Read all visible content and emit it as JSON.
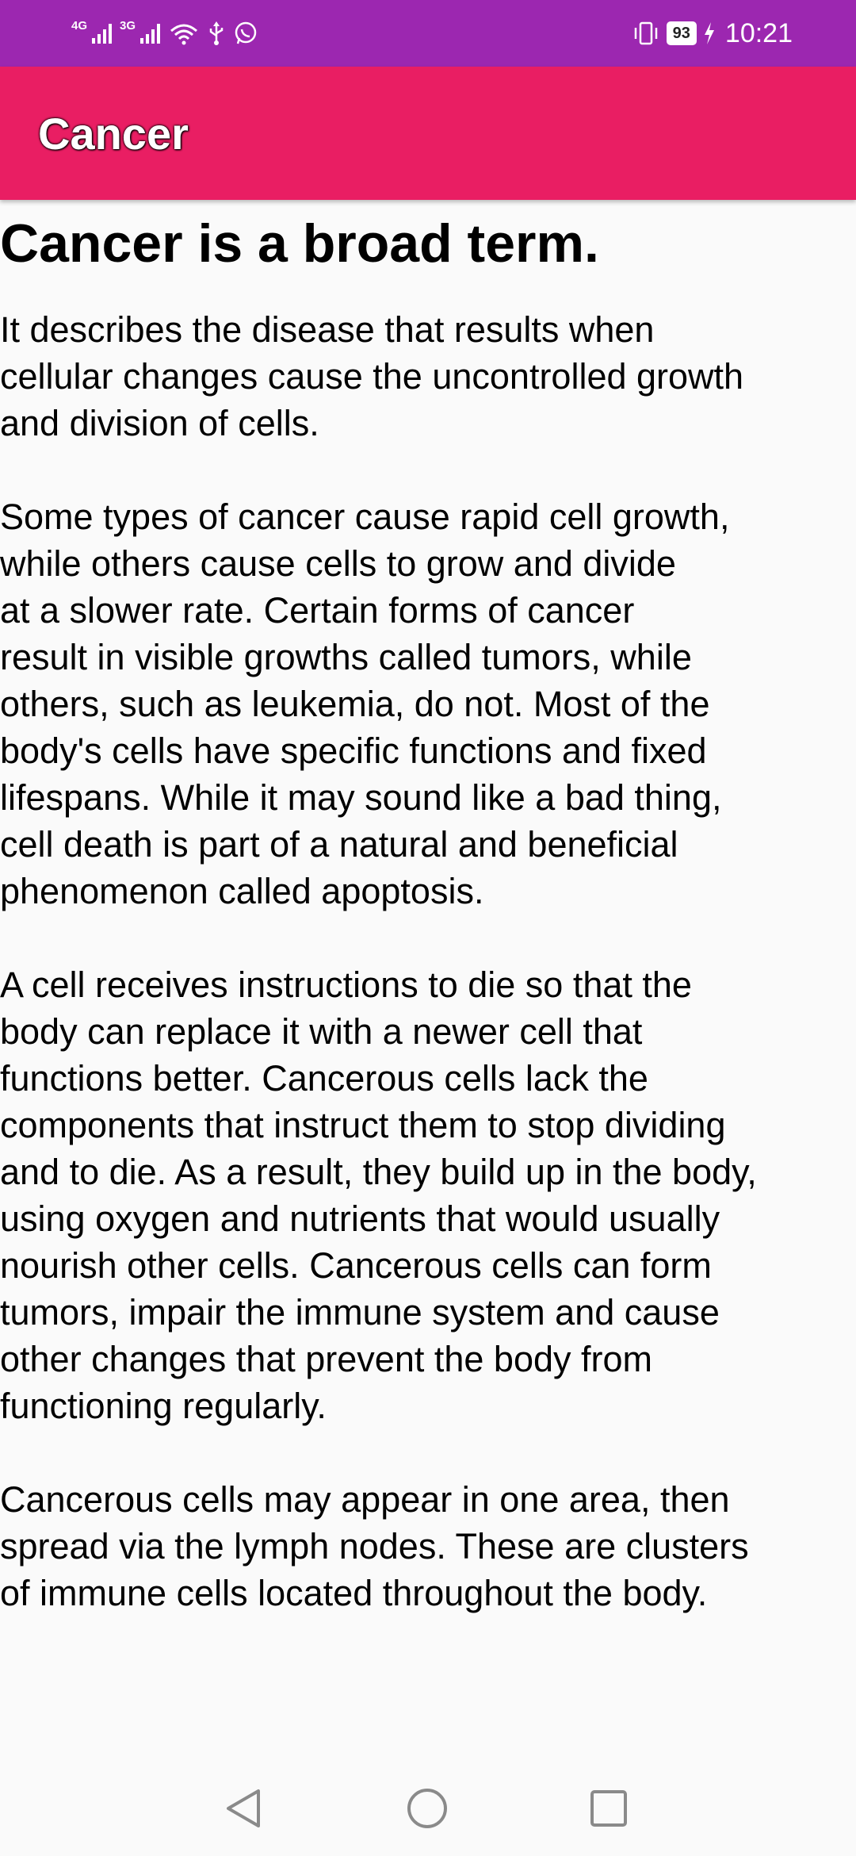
{
  "status_bar": {
    "network_1": "4G",
    "network_2": "3G",
    "battery_level": "93",
    "time": "10:21",
    "icons": [
      "signal-4g-icon",
      "signal-3g-icon",
      "wifi-icon",
      "usb-icon",
      "whatsapp-icon",
      "vibrate-icon",
      "battery-icon",
      "charging-icon"
    ]
  },
  "app_bar": {
    "title": "Cancer",
    "color": "#e91e63"
  },
  "article": {
    "headline": "Cancer is a broad term.",
    "paragraphs": [
      "It describes the disease that results when\ncellular changes cause the uncontrolled growth\nand division of cells.",
      "Some types of cancer cause rapid cell growth,\nwhile others cause cells to grow and divide\nat a slower rate. Certain forms of cancer\nresult in visible growths called tumors, while\nothers, such as leukemia, do not. Most of the\nbody's cells have specific functions and fixed\nlifespans. While it may sound like a bad thing,\ncell death is part of a natural and beneficial\nphenomenon called apoptosis.",
      "A cell receives instructions to die so that the\nbody can replace it with a newer cell that\nfunctions better. Cancerous cells lack the\ncomponents that instruct them to stop dividing\nand to die. As a result, they build up in the body,\nusing oxygen and nutrients that would usually\nnourish other cells. Cancerous cells can form\ntumors, impair the immune system and cause\nother changes that prevent the body from\nfunctioning regularly.",
      "Cancerous cells may appear in one area, then\nspread via the lymph nodes. These are clusters\nof immune cells located throughout the body."
    ]
  },
  "nav_bar": {
    "buttons": [
      "back-icon",
      "home-icon",
      "recents-icon"
    ]
  },
  "colors": {
    "status_bar": "#9c27b0",
    "app_bar": "#e91e63",
    "background": "#fafafa"
  }
}
